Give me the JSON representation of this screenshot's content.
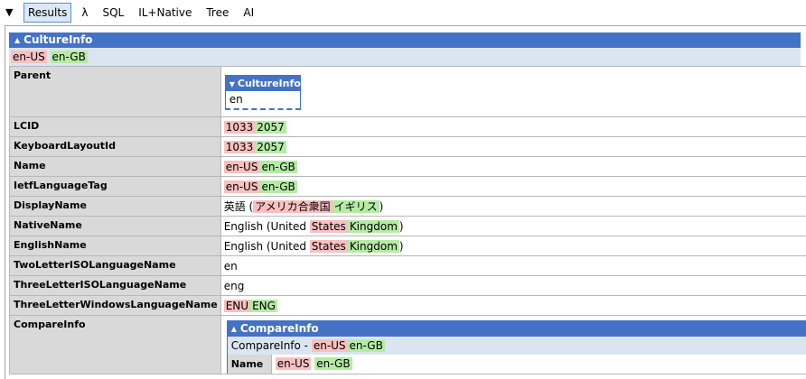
{
  "toolbar": {
    "toggle_glyph": "▼",
    "tabs": [
      {
        "label": "Results",
        "active": true
      },
      {
        "label": "λ",
        "active": false
      },
      {
        "label": "SQL",
        "active": false
      },
      {
        "label": "IL+Native",
        "active": false
      },
      {
        "label": "Tree",
        "active": false
      },
      {
        "label": "AI",
        "active": false
      }
    ]
  },
  "root": {
    "type_name": "CultureInfo",
    "subtitle_old": "en-US",
    "subtitle_new": "en-GB"
  },
  "rows": {
    "parent": {
      "key": "Parent",
      "nested_type": "CultureInfo",
      "nested_value": "en"
    },
    "lcid": {
      "key": "LCID",
      "old": "1033",
      "new": "2057"
    },
    "keyboard": {
      "key": "KeyboardLayoutId",
      "old": "1033",
      "new": "2057"
    },
    "name": {
      "key": "Name",
      "old": "en-US",
      "new": "en-GB"
    },
    "ietf": {
      "key": "IetfLanguageTag",
      "old": "en-US",
      "new": "en-GB"
    },
    "display": {
      "key": "DisplayName",
      "prefix": "英語 (",
      "old": "アメリカ合衆国",
      "new": "イギリス",
      "suffix": ")"
    },
    "native": {
      "key": "NativeName",
      "prefix": "English (United ",
      "old": "States",
      "new": "Kingdom",
      "suffix": ")"
    },
    "english": {
      "key": "EnglishName",
      "prefix": "English (United ",
      "old": "States",
      "new": "Kingdom",
      "suffix": ")"
    },
    "two": {
      "key": "TwoLetterISOLanguageName",
      "value": "en"
    },
    "three": {
      "key": "ThreeLetterISOLanguageName",
      "value": "eng"
    },
    "threewin": {
      "key": "ThreeLetterWindowsLanguageName",
      "old": "ENU",
      "new": "ENG"
    },
    "compare": {
      "key": "CompareInfo",
      "nested_type": "CompareInfo",
      "subtitle_prefix": "CompareInfo - ",
      "subtitle_old": "en-US",
      "subtitle_new": "en-GB",
      "name_key": "Name",
      "name_old": "en-US",
      "name_new": "en-GB"
    }
  },
  "colors": {
    "header_blue": "#4472c4",
    "subheader_blue": "#dbe5f1",
    "diff_removed": "#f8c0c0",
    "diff_added": "#b5eba5",
    "key_gray": "#d9d9d9"
  }
}
